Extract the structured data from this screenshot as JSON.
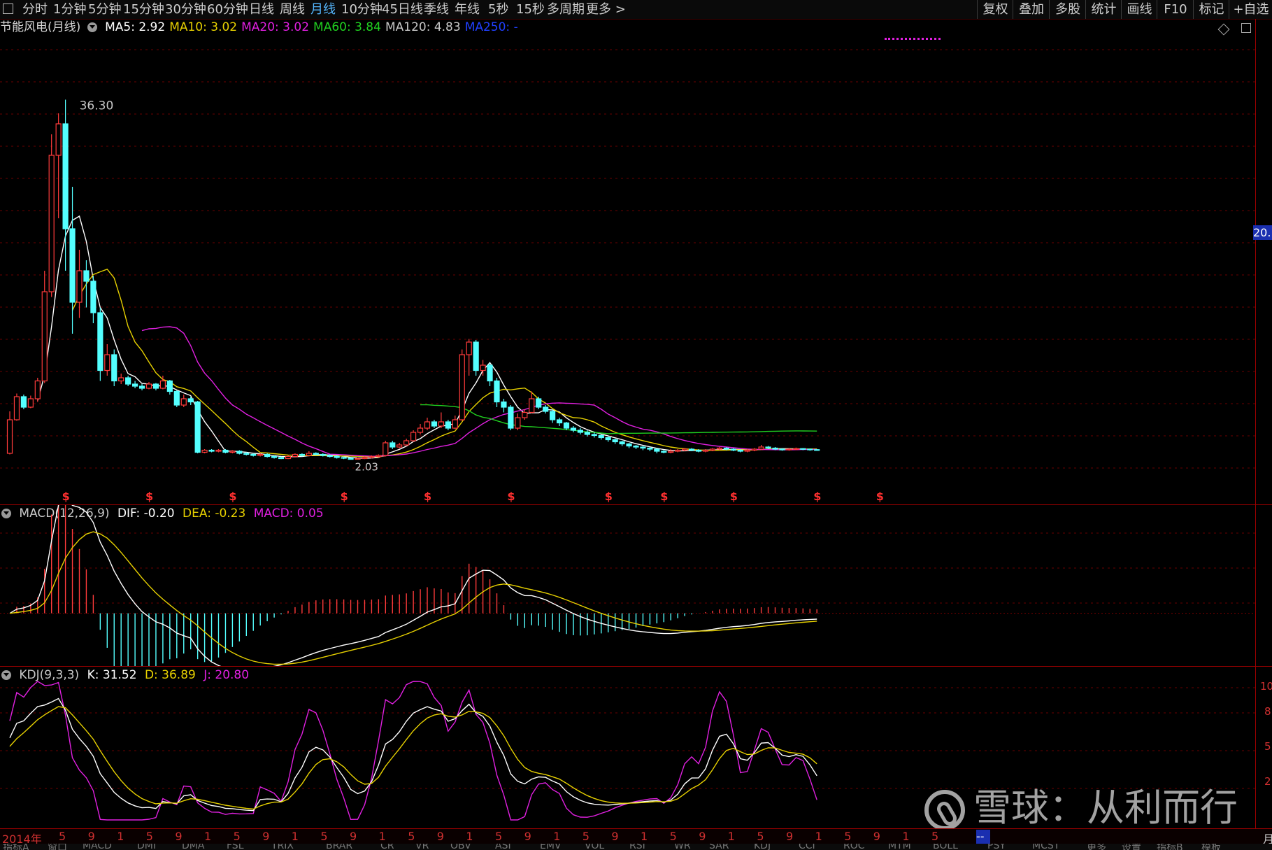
{
  "topbar": {
    "tabs": [
      "分时",
      "1分钟",
      "5分钟",
      "15分钟",
      "30分钟",
      "60分钟",
      "日线",
      "周线",
      "月线",
      "10分钟",
      "45日线",
      "季线",
      "年线",
      "5秒",
      "15秒",
      "多周期",
      "更多 >"
    ],
    "active_tab": "月线",
    "right_buttons": [
      "复权",
      "叠加",
      "多股",
      "统计",
      "画线",
      "F10",
      "标记",
      "+自选"
    ]
  },
  "main": {
    "stock_name": "节能风电(月线)",
    "ma": [
      {
        "label": "MA5: 2.92",
        "color": "#ffffff"
      },
      {
        "label": "MA10: 3.02",
        "color": "#e6d000"
      },
      {
        "label": "MA20: 3.02",
        "color": "#e020e0"
      },
      {
        "label": "MA60: 3.84",
        "color": "#20d020"
      },
      {
        "label": "MA120: 4.83",
        "color": "#c8c8c8"
      },
      {
        "label": "MA250: -",
        "color": "#2040ff"
      }
    ],
    "high_label": "36.30",
    "low_label": "2.03",
    "price_tag": "20.",
    "window_icons": [
      "diamond-icon",
      "window-icon"
    ]
  },
  "macd": {
    "title": "MACD(12,26,9)",
    "dif": "DIF: -0.20",
    "dea": "DEA: -0.23",
    "macd": "MACD: 0.05"
  },
  "kdj": {
    "title": "KDJ(9,3,3)",
    "k": "K: 31.52",
    "d": "D: 36.89",
    "j": "J: 20.80"
  },
  "right_axis": {
    "kdj_top": "10",
    "kdj_mid1": "8",
    "kdj_mid2": "5",
    "kdj_low": "2"
  },
  "time_axis": {
    "first": "2014年",
    "marks": [
      "5",
      "9",
      "1",
      "5",
      "9",
      "1",
      "5",
      "9",
      "1",
      "5",
      "9",
      "1",
      "5",
      "9",
      "1",
      "5",
      "9",
      "1",
      "5",
      "9",
      "1",
      "5",
      "9",
      "1",
      "5",
      "9",
      "1",
      "5",
      "9",
      "1",
      "5"
    ],
    "period_label": "月",
    "cursor_label": "--"
  },
  "bottom_tabs": [
    "指标A",
    "窗口",
    "MACD",
    "DMI",
    "DMA",
    "FSL",
    "TRIX",
    "BRAR",
    "CR",
    "VR",
    "OBV",
    "ASI",
    "EMV",
    "VOL",
    "RSI",
    "WR",
    "SAR",
    "KDJ",
    "CCI",
    "ROC",
    "MTM",
    "BOLL",
    "PSY",
    "MCST",
    "更多",
    "设置",
    "指标B",
    "模板"
  ],
  "dividend_marker": "$",
  "watermark": "雪球：从利而行",
  "chart_data": {
    "type": "candlestick",
    "title": "节能风电(月线)",
    "price_range": [
      0,
      42
    ],
    "x": [
      "2014-09",
      "2014-10",
      "2014-11",
      "2014-12",
      "2015-01",
      "2015-02",
      "2015-03",
      "2015-04",
      "2015-05",
      "2015-06",
      "2015-07",
      "2015-08",
      "2015-09",
      "2015-10",
      "2015-11",
      "2015-12",
      "2016-01",
      "2016-02",
      "2016-03",
      "2016-04",
      "2016-05",
      "2016-06",
      "2016-07",
      "2016-08",
      "2016-09",
      "2016-10",
      "2016-11",
      "2016-12",
      "2017-01",
      "2017-02",
      "2017-03",
      "2017-04",
      "2017-05",
      "2017-06",
      "2017-07",
      "2017-08",
      "2017-09",
      "2017-10",
      "2017-11",
      "2017-12",
      "2018-01",
      "2018-02",
      "2018-03",
      "2018-04",
      "2018-05",
      "2018-06",
      "2018-07",
      "2018-08",
      "2018-09",
      "2018-10",
      "2018-11",
      "2018-12",
      "2019-01",
      "2019-02",
      "2019-03",
      "2019-04",
      "2019-05",
      "2019-06",
      "2019-07",
      "2019-08",
      "2019-09",
      "2019-10",
      "2019-11",
      "2019-12",
      "2020-01",
      "2020-02",
      "2020-03",
      "2020-04",
      "2020-05",
      "2020-06",
      "2020-07",
      "2020-08",
      "2020-09",
      "2020-10",
      "2020-11",
      "2020-12",
      "2021-01",
      "2021-02",
      "2021-03",
      "2021-04",
      "2021-05",
      "2021-06",
      "2021-07",
      "2021-08",
      "2021-09",
      "2021-10",
      "2021-11",
      "2021-12",
      "2022-01",
      "2022-02",
      "2022-03",
      "2022-04",
      "2022-05",
      "2022-06",
      "2022-07",
      "2022-08",
      "2022-09",
      "2022-10",
      "2022-11",
      "2022-12",
      "2023-01",
      "2023-02",
      "2023-03",
      "2023-04",
      "2023-05",
      "2023-06",
      "2023-07",
      "2023-08",
      "2023-09",
      "2023-10",
      "2023-11",
      "2023-12",
      "2024-01",
      "2024-02",
      "2024-03",
      "2024-04",
      "2024-05",
      "2024-06",
      "2024-07",
      "2024-08",
      "2024-09",
      "2024-10",
      "2024-11",
      "2024-12",
      "2025-01",
      "2025-02",
      "2025-03",
      "2025-04",
      "2025-05",
      "2025-06",
      "2025-07",
      "2025-08",
      "2025-09",
      "2025-10",
      "2025-11",
      "2025-12"
    ],
    "candles": [
      [
        2.6,
        5.8,
        6.6,
        2.5
      ],
      [
        5.8,
        8.0,
        8.3,
        5.7
      ],
      [
        8.0,
        7.0,
        8.2,
        6.8
      ],
      [
        7.0,
        7.8,
        8.1,
        6.9
      ],
      [
        7.8,
        9.5,
        9.8,
        7.5
      ],
      [
        9.5,
        18.0,
        20.0,
        9.3
      ],
      [
        18.0,
        31.0,
        33.0,
        17.5
      ],
      [
        31.0,
        34.0,
        35.0,
        25.0
      ],
      [
        34.0,
        24.0,
        36.3,
        20.0
      ],
      [
        24.0,
        17.0,
        28.0,
        14.0
      ],
      [
        17.0,
        20.0,
        22.0,
        15.5
      ],
      [
        20.0,
        19.0,
        21.0,
        16.5
      ],
      [
        19.0,
        16.0,
        19.5,
        15.0
      ],
      [
        16.0,
        10.5,
        16.5,
        9.5
      ],
      [
        10.5,
        12.0,
        13.0,
        10.0
      ],
      [
        12.0,
        9.5,
        12.5,
        9.0
      ],
      [
        9.5,
        9.8,
        10.2,
        9.2
      ],
      [
        9.8,
        9.2,
        10.0,
        9.0
      ],
      [
        9.2,
        9.0,
        9.5,
        8.8
      ],
      [
        9.0,
        8.8,
        9.2,
        8.6
      ],
      [
        8.8,
        9.2,
        9.4,
        8.7
      ],
      [
        9.2,
        8.8,
        9.3,
        8.6
      ],
      [
        8.8,
        9.5,
        10.0,
        8.7
      ],
      [
        9.5,
        8.5,
        9.6,
        8.2
      ],
      [
        8.5,
        7.2,
        8.6,
        7.0
      ],
      [
        7.2,
        7.8,
        8.2,
        7.0
      ],
      [
        7.8,
        7.5,
        8.0,
        7.2
      ],
      [
        7.5,
        2.7,
        7.6,
        2.6
      ],
      [
        2.7,
        2.9,
        3.0,
        2.6
      ],
      [
        2.9,
        2.8,
        3.0,
        2.7
      ],
      [
        2.8,
        2.9,
        3.0,
        2.7
      ],
      [
        2.9,
        2.7,
        3.0,
        2.6
      ],
      [
        2.7,
        2.8,
        2.9,
        2.6
      ],
      [
        2.8,
        2.6,
        2.9,
        2.5
      ],
      [
        2.6,
        2.5,
        2.7,
        2.4
      ],
      [
        2.5,
        2.4,
        2.6,
        2.3
      ],
      [
        2.4,
        2.5,
        2.6,
        2.3
      ],
      [
        2.5,
        2.3,
        2.6,
        2.2
      ],
      [
        2.3,
        2.2,
        2.4,
        2.1
      ],
      [
        2.2,
        2.1,
        2.3,
        2.05
      ],
      [
        2.1,
        2.3,
        2.4,
        2.05
      ],
      [
        2.3,
        2.5,
        2.6,
        2.2
      ],
      [
        2.5,
        2.4,
        2.6,
        2.3
      ],
      [
        2.4,
        2.6,
        2.8,
        2.3
      ],
      [
        2.6,
        2.5,
        2.7,
        2.4
      ],
      [
        2.5,
        2.4,
        2.6,
        2.3
      ],
      [
        2.4,
        2.3,
        2.5,
        2.2
      ],
      [
        2.3,
        2.2,
        2.4,
        2.1
      ],
      [
        2.2,
        2.15,
        2.3,
        2.05
      ],
      [
        2.15,
        2.03,
        2.2,
        2.03
      ],
      [
        2.03,
        2.1,
        2.2,
        2.03
      ],
      [
        2.1,
        2.2,
        2.3,
        2.05
      ],
      [
        2.2,
        2.3,
        2.4,
        2.1
      ],
      [
        2.3,
        2.4,
        2.5,
        2.2
      ],
      [
        2.4,
        3.6,
        3.8,
        2.3
      ],
      [
        3.6,
        3.2,
        3.8,
        3.0
      ],
      [
        3.2,
        3.4,
        3.6,
        3.1
      ],
      [
        3.4,
        3.8,
        4.0,
        3.3
      ],
      [
        3.8,
        4.6,
        4.8,
        3.7
      ],
      [
        4.6,
        5.0,
        5.4,
        4.4
      ],
      [
        5.0,
        5.6,
        6.0,
        4.8
      ],
      [
        5.6,
        5.2,
        5.8,
        5.0
      ],
      [
        5.2,
        5.6,
        6.5,
        5.0
      ],
      [
        5.6,
        5.0,
        5.8,
        4.8
      ],
      [
        5.0,
        5.8,
        6.2,
        4.9
      ],
      [
        5.8,
        12.0,
        12.5,
        5.7
      ],
      [
        12.0,
        13.2,
        13.5,
        10.0
      ],
      [
        13.2,
        10.5,
        13.4,
        10.0
      ],
      [
        10.5,
        11.0,
        11.5,
        10.0
      ],
      [
        11.0,
        9.5,
        11.2,
        9.0
      ],
      [
        9.5,
        7.5,
        9.8,
        7.0
      ],
      [
        7.5,
        7.0,
        7.8,
        6.5
      ],
      [
        7.0,
        5.0,
        7.2,
        4.8
      ],
      [
        5.0,
        6.0,
        6.4,
        4.8
      ],
      [
        6.0,
        6.5,
        6.8,
        5.8
      ],
      [
        6.5,
        7.8,
        8.5,
        6.4
      ],
      [
        7.8,
        7.0,
        8.0,
        6.8
      ],
      [
        7.0,
        6.6,
        7.2,
        6.4
      ],
      [
        6.6,
        5.8,
        6.8,
        5.5
      ],
      [
        5.8,
        5.5,
        6.0,
        5.2
      ],
      [
        5.5,
        5.0,
        5.6,
        4.8
      ],
      [
        5.0,
        4.8,
        5.2,
        4.6
      ],
      [
        4.8,
        4.6,
        5.0,
        4.4
      ],
      [
        4.6,
        4.4,
        4.8,
        4.2
      ],
      [
        4.4,
        4.3,
        4.6,
        4.1
      ],
      [
        4.3,
        4.1,
        4.4,
        3.9
      ],
      [
        4.1,
        3.9,
        4.2,
        3.7
      ],
      [
        3.9,
        3.7,
        4.0,
        3.5
      ],
      [
        3.7,
        3.5,
        3.8,
        3.3
      ],
      [
        3.5,
        3.3,
        3.6,
        3.1
      ],
      [
        3.3,
        3.2,
        3.4,
        3.0
      ],
      [
        3.2,
        3.1,
        3.3,
        2.9
      ],
      [
        3.1,
        3.0,
        3.2,
        2.8
      ],
      [
        3.0,
        2.8,
        3.1,
        2.6
      ],
      [
        2.8,
        2.7,
        2.9,
        2.6
      ],
      [
        2.7,
        2.8,
        3.0,
        2.6
      ],
      [
        2.8,
        2.9,
        3.0,
        2.7
      ],
      [
        2.9,
        3.0,
        3.1,
        2.8
      ],
      [
        3.0,
        2.9,
        3.1,
        2.8
      ],
      [
        2.9,
        2.8,
        3.0,
        2.7
      ],
      [
        2.8,
        2.9,
        3.0,
        2.7
      ],
      [
        2.9,
        3.0,
        3.1,
        2.8
      ],
      [
        3.0,
        3.1,
        3.2,
        2.9
      ],
      [
        3.1,
        3.0,
        3.2,
        2.9
      ],
      [
        3.0,
        2.9,
        3.1,
        2.8
      ],
      [
        2.9,
        2.8,
        3.0,
        2.7
      ],
      [
        2.8,
        2.9,
        3.0,
        2.7
      ],
      [
        2.9,
        3.0,
        3.1,
        2.8
      ],
      [
        3.0,
        3.2,
        3.4,
        2.9
      ],
      [
        3.2,
        3.1,
        3.3,
        3.0
      ],
      [
        3.1,
        3.0,
        3.2,
        2.9
      ],
      [
        3.0,
        2.95,
        3.1,
        2.85
      ],
      [
        2.95,
        3.0,
        3.1,
        2.85
      ],
      [
        3.0,
        3.05,
        3.15,
        2.9
      ],
      [
        3.05,
        3.0,
        3.1,
        2.9
      ],
      [
        3.0,
        2.95,
        3.05,
        2.85
      ],
      [
        2.95,
        2.92,
        3.0,
        2.85
      ]
    ],
    "ma_series": [
      {
        "name": "MA5",
        "color": "#ffffff"
      },
      {
        "name": "MA10",
        "color": "#e6d000"
      },
      {
        "name": "MA20",
        "color": "#e020e0"
      },
      {
        "name": "MA60",
        "color": "#20d020"
      },
      {
        "name": "MA120",
        "color": "#c8c8c8"
      }
    ],
    "dividend_months_index": [
      8,
      20,
      32,
      48,
      60,
      72,
      86,
      94,
      104,
      116,
      125
    ],
    "macd_range": [
      -2.0,
      4.0
    ],
    "kdj_range": [
      0,
      100
    ]
  }
}
